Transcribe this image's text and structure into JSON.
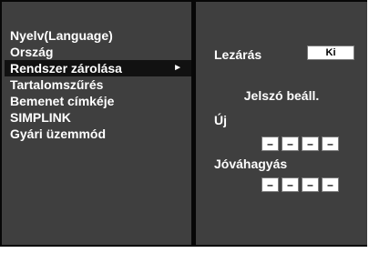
{
  "menu": {
    "items": [
      {
        "label": "Nyelv(Language)"
      },
      {
        "label": "Ország"
      },
      {
        "label": "Rendszer zárolása",
        "selected": true,
        "arrow": "►"
      },
      {
        "label": "Tartalomszűrés"
      },
      {
        "label": "Bemenet címkéje"
      },
      {
        "label": "SIMPLINK"
      },
      {
        "label": "Gyári üzemmód"
      }
    ]
  },
  "lock": {
    "label": "Lezárás",
    "value": "Ki"
  },
  "password": {
    "title": "Jelszó beáll.",
    "new_label": "Új",
    "new_digits": [
      "–",
      "–",
      "–",
      "–"
    ],
    "confirm_label": "Jóváhagyás",
    "confirm_digits": [
      "–",
      "–",
      "–",
      "–"
    ]
  },
  "colors": {
    "background": "#070707",
    "panel": "#3f3f3f",
    "selected": "#111111",
    "text": "#ffffff"
  }
}
